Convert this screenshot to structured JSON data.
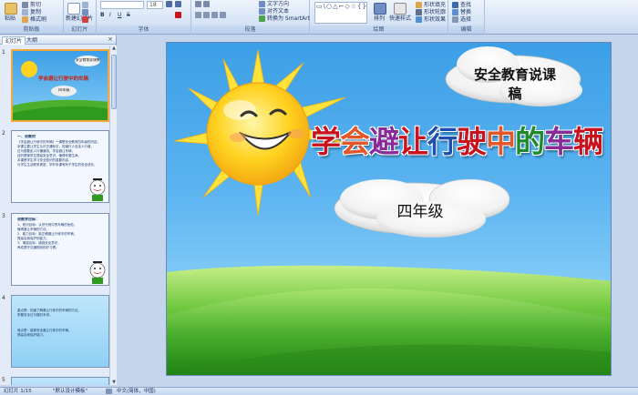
{
  "ribbon": {
    "clipboard": {
      "paste": "粘贴",
      "cut": "剪切",
      "copy": "复制",
      "format_painter": "格式刷",
      "label": "剪贴板"
    },
    "slides": {
      "new_slide": "新建幻灯片",
      "layout": "版式",
      "reset": "重设",
      "delete": "删除",
      "label": "幻灯片"
    },
    "font": {
      "font_name": "",
      "font_size": "18",
      "label": "字体"
    },
    "paragraph": {
      "text_direction": "文字方向",
      "align_text": "对齐文本",
      "convert_smartart": "转换为 SmartArt",
      "label": "段落"
    },
    "drawing": {
      "shapes_glyphs": "▭\\○△⌐◇☆{}",
      "arrange": "排列",
      "quick_styles": "快速样式",
      "shape_fill": "形状填充",
      "shape_outline": "形状轮廓",
      "shape_effects": "形状效果",
      "label": "绘图"
    },
    "editing": {
      "find": "查找",
      "replace": "替换",
      "select": "选择",
      "label": "编辑"
    }
  },
  "left_panel": {
    "tabs": [
      "幻灯片",
      "大纲"
    ],
    "close": "×",
    "slides": [
      {
        "num": "1",
        "tag": "安全教育说课稿",
        "title": "学会避让行驶中的车辆",
        "grade": "四年级"
      },
      {
        "num": "2",
        "heading": "一、说教材",
        "lines": [
          "《学会避让行驶中的车辆》一课是安全教育四年级的内容，",
          "本课主要让学生认识交通标志，知道行人应走人行道，",
          "过马路要走人行横道线。学会避让车辆，",
          "目的是使学生提高安全意识，懂得珍爱生命。",
          "本课是学生学习安全知识的重要内容，",
          "与学生生活联系紧密，学好本课有利于学生的安全成长。"
        ]
      },
      {
        "num": "3",
        "heading": "说教学目标：",
        "lines": [
          "1、知识目标：认识行驶中的车辆的危险，",
          "懂得避让车辆的方法。",
          "2、能力目标：能正确避让行驶中的车辆，",
          "提高自我保护的能力。",
          "3、情感目标：增强安全意识，",
          "养成遵守交通规则的好习惯。"
        ]
      },
      {
        "num": "4",
        "lines": [
          "重点是：知道了解避让行驶中的车辆的方法，",
          "掌握安全过马路的本领。",
          "难点是：能够安全避让行驶中的车辆，",
          "提高自我保护能力。"
        ]
      },
      {
        "num": "5"
      }
    ]
  },
  "slide": {
    "tag": "安全教育说课稿",
    "title_chars": [
      "学",
      "会",
      "避",
      "让",
      "行",
      "驶",
      "中",
      "的",
      "车",
      "辆"
    ],
    "title_colors": [
      "#c8121e",
      "#e2562a",
      "#8a2a9a",
      "#c8121e",
      "#1d4fb3",
      "#c8121e",
      "#e2562a",
      "#1f8a2c",
      "#8a2a9a",
      "#c8121e"
    ],
    "grade": "四年级"
  },
  "status": {
    "slide_counter": "幻灯片 1/15",
    "theme": "\"默认设计模板\"",
    "language": "中文(简体，中国)"
  }
}
